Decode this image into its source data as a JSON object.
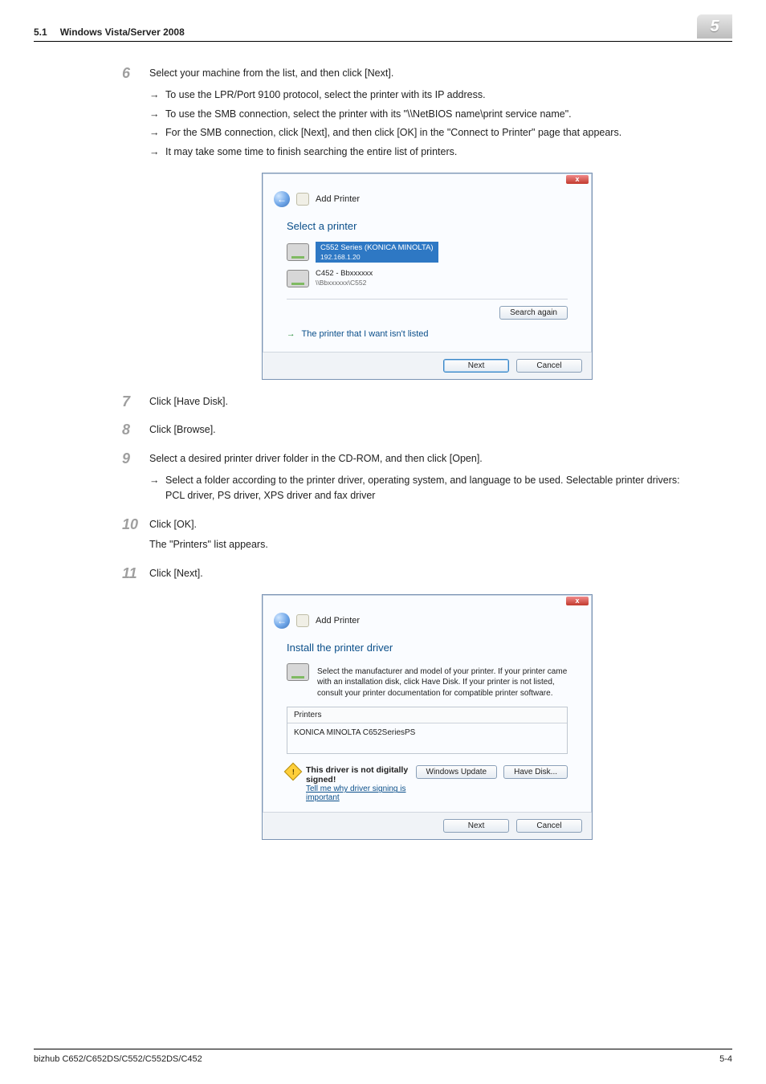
{
  "header": {
    "section": "5.1",
    "title": "Windows Vista/Server 2008",
    "chapter": "5"
  },
  "steps": {
    "s6": {
      "num": "6",
      "text": "Select your machine from the list, and then click [Next].",
      "b1": "To use the LPR/Port 9100 protocol, select the printer with its IP address.",
      "b2": "To use the SMB connection, select the printer with its \"\\\\NetBIOS name\\print service name\".",
      "b3": "For the SMB connection, click [Next], and then click [OK] in the \"Connect to Printer\" page that appears.",
      "b4": "It may take some time to finish searching the entire list of printers."
    },
    "s7": {
      "num": "7",
      "text": "Click [Have Disk]."
    },
    "s8": {
      "num": "8",
      "text": "Click [Browse]."
    },
    "s9": {
      "num": "9",
      "text": "Select a desired printer driver folder in the CD-ROM, and then click [Open].",
      "b1": "Select a folder according to the printer driver, operating system, and language to be used. Selectable printer drivers:",
      "b2": "PCL driver, PS driver, XPS driver and fax driver"
    },
    "s10": {
      "num": "10",
      "text": "Click [OK].",
      "note": "The \"Printers\" list appears."
    },
    "s11": {
      "num": "11",
      "text": "Click [Next]."
    }
  },
  "dlg1": {
    "title": "Add Printer",
    "heading": "Select a printer",
    "item1_l1": "C552 Series (KONICA MINOLTA)",
    "item1_l2": "192.168.1.20",
    "item2_l1": "C452 - Bbxxxxxx",
    "item2_l2": "\\\\Bbxxxxxx\\C552",
    "search": "Search again",
    "link": "The printer that I want isn't listed",
    "next": "Next",
    "cancel": "Cancel"
  },
  "dlg2": {
    "title": "Add Printer",
    "heading": "Install the printer driver",
    "desc": "Select the manufacturer and model of your printer. If your printer came with an installation disk, click Have Disk. If your printer is not listed, consult your printer documentation for compatible printer software.",
    "printers_h": "Printers",
    "printers_item": "KONICA MINOLTA C652SeriesPS",
    "warn1": "This driver is not digitally signed!",
    "warn2": "Tell me why driver signing is important",
    "wu": "Windows Update",
    "hd": "Have Disk...",
    "next": "Next",
    "cancel": "Cancel"
  },
  "footer": {
    "product": "bizhub C652/C652DS/C552/C552DS/C452",
    "page": "5-4"
  }
}
